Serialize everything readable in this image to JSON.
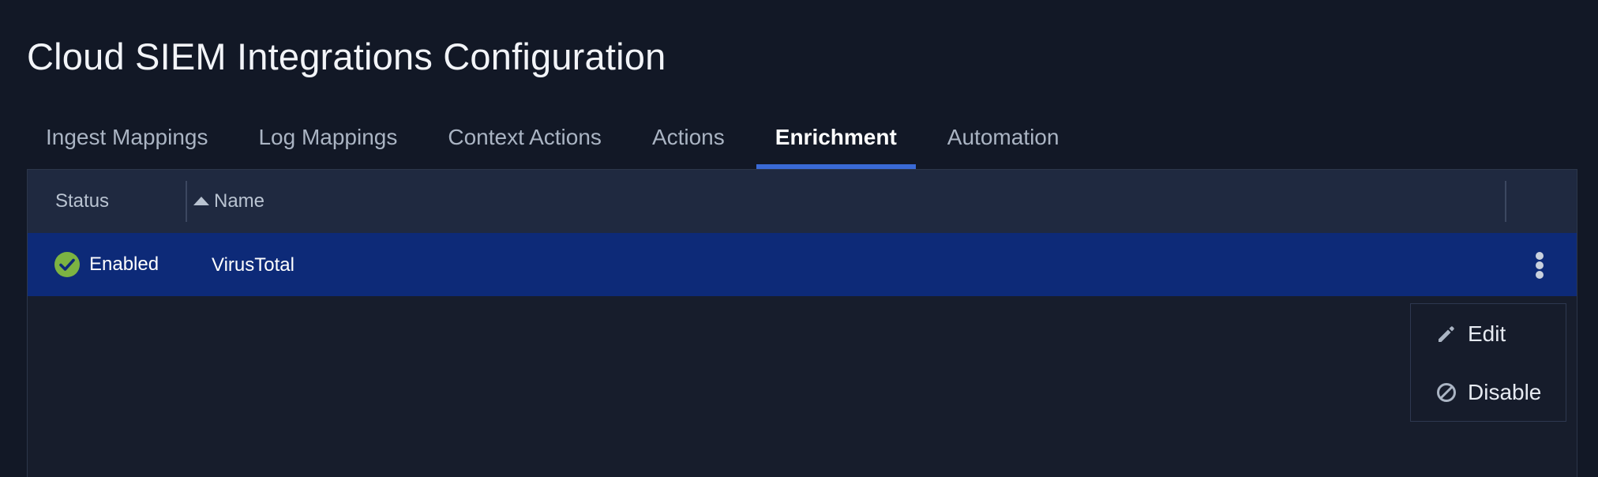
{
  "page": {
    "title": "Cloud SIEM Integrations Configuration"
  },
  "tabs": [
    {
      "label": "Ingest Mappings",
      "active": false
    },
    {
      "label": "Log Mappings",
      "active": false
    },
    {
      "label": "Context Actions",
      "active": false
    },
    {
      "label": "Actions",
      "active": false
    },
    {
      "label": "Enrichment",
      "active": true
    },
    {
      "label": "Automation",
      "active": false
    }
  ],
  "table": {
    "columns": {
      "status": "Status",
      "name": "Name"
    },
    "sort": {
      "column": "Name",
      "direction": "ascending"
    },
    "rows": [
      {
        "status": "Enabled",
        "name": "VirusTotal",
        "selected": true
      }
    ]
  },
  "row_menu": {
    "items": [
      {
        "label": "Edit",
        "icon": "pencil-icon"
      },
      {
        "label": "Disable",
        "icon": "disable-icon"
      }
    ]
  },
  "colors": {
    "background": "#121826",
    "panel": "#171d2c",
    "header": "#1f2940",
    "selected_row": "#0d2a78",
    "tab_indicator": "#3a6ad6",
    "status_enabled": "#7cb342"
  }
}
